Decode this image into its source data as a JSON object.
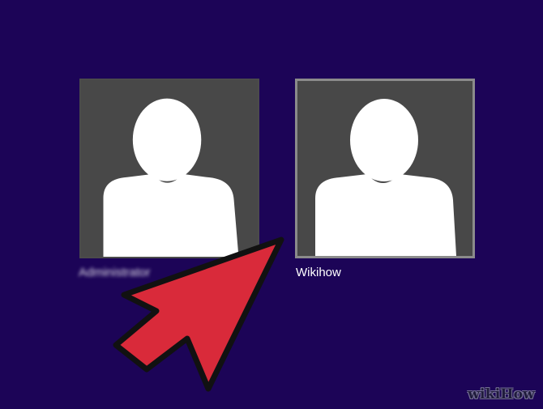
{
  "colors": {
    "background": "#1c0457",
    "tile_background": "#484848",
    "silhouette": "#ffffff",
    "selected_border": "#8b8b8b",
    "arrow_fill": "#d92a3a",
    "arrow_outline": "#111111"
  },
  "users": [
    {
      "name": "Administrator",
      "name_blurred": true,
      "avatar_icon": "user-silhouette-icon"
    },
    {
      "name": "Wikihow",
      "name_blurred": false,
      "avatar_icon": "user-silhouette-icon",
      "selected": true
    }
  ],
  "pointer": {
    "icon": "red-arrow-icon"
  },
  "watermark": {
    "prefix": "wiki",
    "suffix": "How"
  }
}
